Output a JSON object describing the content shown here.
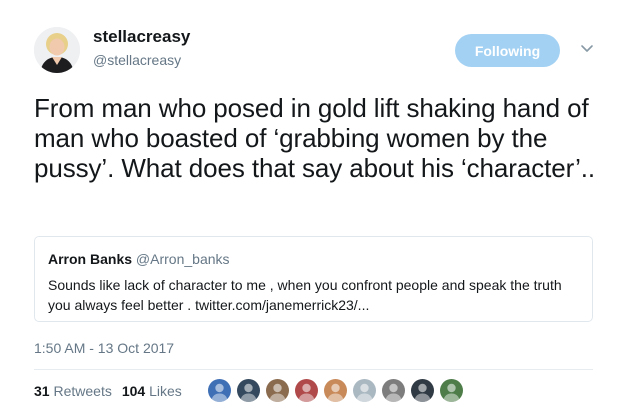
{
  "author": {
    "name": "stellacreasy",
    "handle": "@stellacreasy"
  },
  "follow_button": {
    "label": "Following",
    "color": "#a3d1f3"
  },
  "tweet": {
    "text": "From man who posed in gold lift shaking hand of man who boasted of ‘grabbing women by the pussy’. What does that say about his ‘character’.."
  },
  "quote": {
    "name": "Arron Banks",
    "handle": "@Arron_banks",
    "text": "Sounds like lack of character to me , when you confront people and speak the truth you always feel better . twitter.com/janemerrick23/..."
  },
  "timestamp": "1:50 AM - 13 Oct 2017",
  "stats": {
    "retweets_count": "31",
    "retweets_label": "Retweets",
    "likes_count": "104",
    "likes_label": "Likes"
  },
  "likers": [
    {
      "icon": "user-avatar-icon",
      "color": "#3f6fb5"
    },
    {
      "icon": "user-avatar-icon",
      "color": "#34495e"
    },
    {
      "icon": "user-avatar-icon",
      "color": "#8a6b4e"
    },
    {
      "icon": "user-avatar-icon",
      "color": "#b04a4a"
    },
    {
      "icon": "user-avatar-icon",
      "color": "#c98a5a"
    },
    {
      "icon": "user-avatar-icon",
      "color": "#aab8c2"
    },
    {
      "icon": "user-avatar-icon",
      "color": "#7d7d7d"
    },
    {
      "icon": "user-avatar-icon",
      "color": "#2f3a44"
    },
    {
      "icon": "user-avatar-icon",
      "color": "#4e7d4a"
    }
  ],
  "colors": {
    "primary_text": "#14171a",
    "secondary_text": "#657786",
    "border": "#e1e8ed"
  }
}
